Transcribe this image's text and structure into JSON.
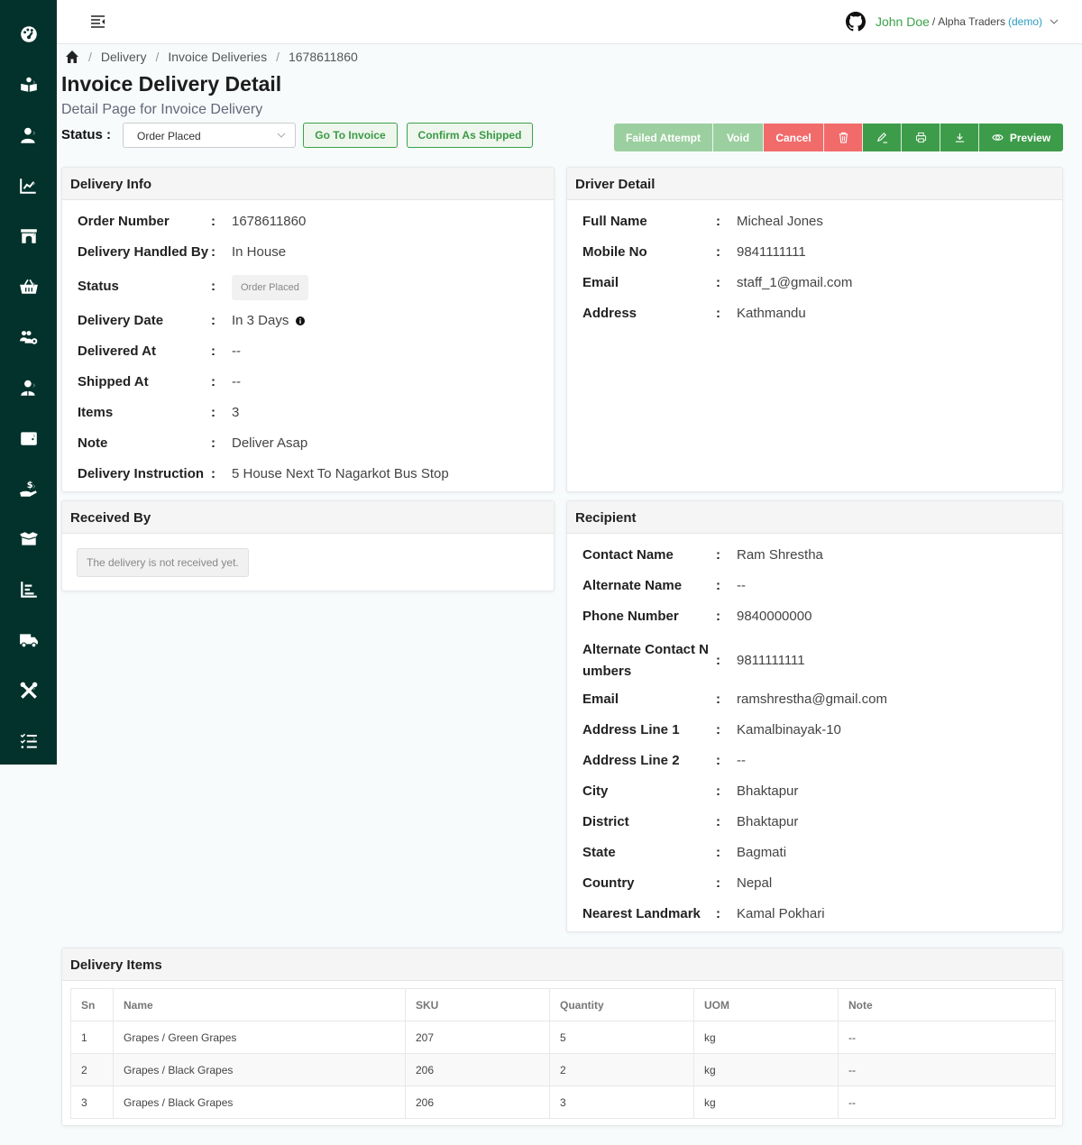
{
  "sidebar": {
    "items": [
      {
        "icon": "dashboard-icon",
        "has_submenu": false
      },
      {
        "icon": "catalog-icon",
        "has_submenu": true
      },
      {
        "icon": "customer-icon",
        "has_submenu": true
      },
      {
        "icon": "sales-chart-icon",
        "has_submenu": true
      },
      {
        "icon": "store-icon",
        "has_submenu": true
      },
      {
        "icon": "basket-icon",
        "has_submenu": true
      },
      {
        "icon": "user-groups-icon",
        "has_submenu": false
      },
      {
        "icon": "staff-icon",
        "has_submenu": true
      },
      {
        "icon": "wallet-icon",
        "has_submenu": true
      },
      {
        "icon": "payment-icon",
        "has_submenu": true
      },
      {
        "icon": "inventory-box-icon",
        "has_submenu": false
      },
      {
        "icon": "reports-icon",
        "has_submenu": false
      },
      {
        "icon": "delivery-truck-icon",
        "has_submenu": false
      },
      {
        "icon": "settings-tools-icon",
        "has_submenu": true
      },
      {
        "icon": "task-list-icon",
        "has_submenu": true
      }
    ]
  },
  "topbar": {
    "user_name": "John Doe",
    "separator": "/",
    "organization": "Alpha Traders",
    "demo_label": "(demo)"
  },
  "breadcrumb": [
    "Delivery",
    "Invoice Deliveries",
    "1678611860"
  ],
  "header": {
    "title": "Invoice Delivery Detail",
    "subtitle": "Detail Page for Invoice Delivery",
    "status_label": "Status :",
    "status_value": "Order Placed"
  },
  "buttons": {
    "go_to_invoice": "Go To Invoice",
    "confirm_shipped": "Confirm As Shipped",
    "failed_attempt": "Failed Attempt",
    "void": "Void",
    "cancel": "Cancel",
    "preview": "Preview"
  },
  "colors": {
    "sidebar": "#02322b",
    "primary_green": "#3d9c49",
    "light_green": "#9ccf9f",
    "danger": "#f26b6b",
    "link_blue": "#2b9cc2"
  },
  "delivery_info": {
    "title": "Delivery Info",
    "rows": [
      {
        "label": "Order Number",
        "value": "1678611860"
      },
      {
        "label": "Delivery Handled By",
        "value": "In House"
      },
      {
        "label": "Status",
        "value": "Order Placed"
      },
      {
        "label": "Delivery Date",
        "value": "In 3 Days"
      },
      {
        "label": "Delivered At",
        "value": "--"
      },
      {
        "label": "Shipped At",
        "value": "--"
      },
      {
        "label": "Items",
        "value": "3"
      },
      {
        "label": "Note",
        "value": "Deliver Asap"
      },
      {
        "label": "Delivery Instruction",
        "value": "5 House Next To Nagarkot Bus Stop"
      }
    ]
  },
  "driver_detail": {
    "title": "Driver Detail",
    "rows": [
      {
        "label": "Full Name",
        "value": "Micheal Jones"
      },
      {
        "label": "Mobile No",
        "value": "9841111111"
      },
      {
        "label": "Email",
        "value": "staff_1@gmail.com"
      },
      {
        "label": "Address",
        "value": "Kathmandu"
      }
    ]
  },
  "received_by": {
    "title": "Received By",
    "notice": "The delivery is not received yet."
  },
  "recipient": {
    "title": "Recipient",
    "rows": [
      {
        "label": "Contact Name",
        "value": "Ram Shrestha"
      },
      {
        "label": "Alternate Name",
        "value": "--"
      },
      {
        "label": "Phone Number",
        "value": "9840000000"
      },
      {
        "label": "Alternate Contact N",
        "label2": "umbers",
        "value": "9811111111"
      },
      {
        "label": "Email",
        "value": "ramshrestha@gmail.com"
      },
      {
        "label": "Address Line 1",
        "value": "Kamalbinayak-10"
      },
      {
        "label": "Address Line 2",
        "value": "--"
      },
      {
        "label": "City",
        "value": "Bhaktapur"
      },
      {
        "label": "District",
        "value": "Bhaktapur"
      },
      {
        "label": "State",
        "value": "Bagmati"
      },
      {
        "label": "Country",
        "value": "Nepal"
      },
      {
        "label": "Nearest Landmark",
        "value": "Kamal Pokhari"
      }
    ]
  },
  "delivery_items": {
    "title": "Delivery Items",
    "columns": [
      "Sn",
      "Name",
      "SKU",
      "Quantity",
      "UOM",
      "Note"
    ],
    "rows": [
      [
        "1",
        "Grapes / Green Grapes",
        "207",
        "5",
        "kg",
        "--"
      ],
      [
        "2",
        "Grapes / Black Grapes",
        "206",
        "2",
        "kg",
        "--"
      ],
      [
        "3",
        "Grapes / Black Grapes",
        "206",
        "3",
        "kg",
        "--"
      ]
    ]
  }
}
